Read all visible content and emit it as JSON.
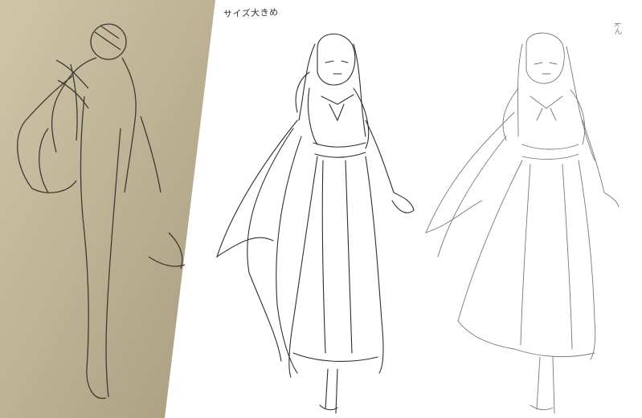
{
  "annotations": {
    "top_note": "サイズ大きめ",
    "side_note": "kん"
  },
  "colors": {
    "paper_photo": "#b9ae92",
    "paper_photo_light": "#d3c9ad",
    "pencil": "#3a3a3a",
    "light_pencil": "#6f6f6f"
  },
  "panels": [
    {
      "name": "rough-gesture-sketch"
    },
    {
      "name": "lined-figure-sketch"
    },
    {
      "name": "light-cleanup-sketch"
    }
  ]
}
